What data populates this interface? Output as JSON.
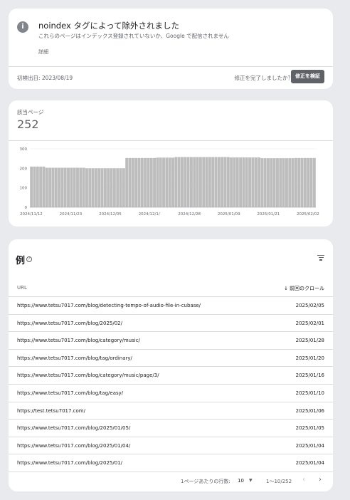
{
  "issue": {
    "icon": "info-icon",
    "title": "noindex タグによって除外されました",
    "description": "これらのページはインデックス登録されていないか、Google で配信されません",
    "details_link": "詳細",
    "first_detected": "初検出日: 2023/08/19",
    "question": "修正を完了しましたか？",
    "validate_button": "修正を検証"
  },
  "affected_pages": {
    "label": "該当ページ",
    "value": "252"
  },
  "chart_data": {
    "type": "bar",
    "title": "",
    "xlabel": "",
    "ylabel": "",
    "ylim": [
      0,
      300
    ],
    "yticks": [
      "0",
      "100",
      "200",
      "300"
    ],
    "xticks": [
      "2024/11/12",
      "2024/11/23",
      "2024/12/05",
      "2024/12/1/",
      "2024/12/28",
      "2025/01/09",
      "2025/01/21",
      "2025/02/02"
    ],
    "color": "#bdbdbd",
    "values": [
      209,
      209,
      209,
      209,
      209,
      203,
      203,
      203,
      203,
      203,
      203,
      203,
      203,
      203,
      203,
      203,
      203,
      203,
      200,
      200,
      200,
      200,
      200,
      200,
      200,
      200,
      200,
      200,
      200,
      200,
      200,
      253,
      253,
      253,
      253,
      253,
      253,
      253,
      253,
      253,
      253,
      255,
      255,
      255,
      255,
      255,
      255,
      258,
      258,
      258,
      258,
      258,
      258,
      258,
      258,
      258,
      258,
      258,
      258,
      258,
      258,
      258,
      258,
      258,
      258,
      256,
      256,
      256,
      256,
      256,
      256,
      256,
      256,
      256,
      256,
      252,
      252,
      252,
      252,
      252,
      252,
      252,
      252,
      252,
      252,
      252,
      253,
      253,
      253,
      253,
      253,
      253,
      253
    ]
  },
  "examples": {
    "title": "例",
    "help_icon": "help-icon",
    "filter_icon": "filter-icon",
    "columns": [
      "URL",
      "前回のクロール"
    ],
    "sort_icon": "arrow-down-icon",
    "rows": [
      {
        "url": "https://www.tetsu7017.com/blog/detecting-tempo-of-audio-file-in-cubase/",
        "date": "2025/02/05"
      },
      {
        "url": "https://www.tetsu7017.com/blog/2025/02/",
        "date": "2025/02/01"
      },
      {
        "url": "https://www.tetsu7017.com/blog/category/music/",
        "date": "2025/01/28"
      },
      {
        "url": "https://www.tetsu7017.com/blog/tag/ordinary/",
        "date": "2025/01/20"
      },
      {
        "url": "https://www.tetsu7017.com/blog/category/music/page/3/",
        "date": "2025/01/16"
      },
      {
        "url": "https://www.tetsu7017.com/blog/tag/easy/",
        "date": "2025/01/10"
      },
      {
        "url": "https://test.tetsu7017.com/",
        "date": "2025/01/06"
      },
      {
        "url": "https://www.tetsu7017.com/blog/2025/01/05/",
        "date": "2025/01/05"
      },
      {
        "url": "https://www.tetsu7017.com/blog/2025/01/04/",
        "date": "2025/01/04"
      },
      {
        "url": "https://www.tetsu7017.com/blog/2025/01/",
        "date": "2025/01/04"
      }
    ],
    "pagination": {
      "rows_per_page_label": "1ページあたりの行数:",
      "rows_per_page_value": "10",
      "range": "1〜10/252",
      "prev_icon": "chevron-left-icon",
      "next_icon": "chevron-right-icon"
    }
  }
}
